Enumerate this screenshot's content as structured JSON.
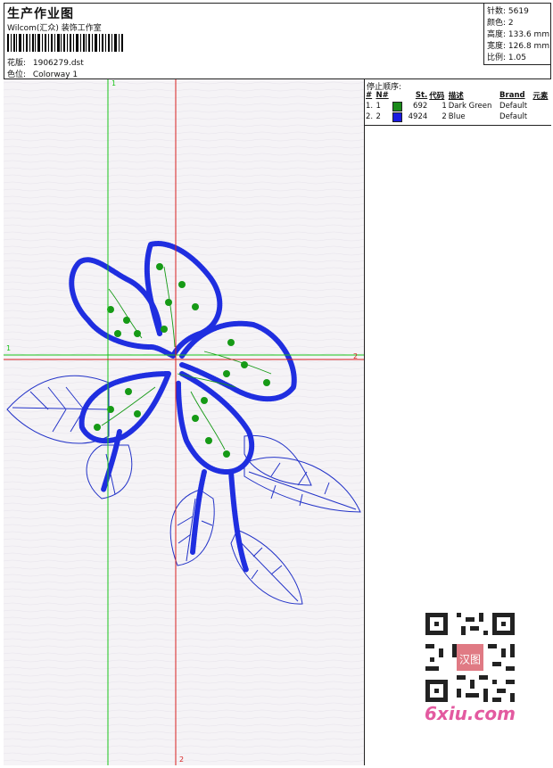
{
  "header": {
    "title": "生产作业图",
    "studio": "Wilcom(汇众) 装饰工作室",
    "file_key": "花版:",
    "file_val": "1906279.dst",
    "color_key": "色位:",
    "color_val": "Colorway 1"
  },
  "stats": [
    {
      "key": "针数:",
      "val": "5619"
    },
    {
      "key": "颜色:",
      "val": "2"
    },
    {
      "key": "高度:",
      "val": "133.6 mm"
    },
    {
      "key": "宽度:",
      "val": "126.8 mm"
    },
    {
      "key": "比例:",
      "val": "1.05"
    }
  ],
  "stop_sequence": {
    "title": "停止顺序:",
    "columns": [
      "#",
      "N#",
      "St.",
      "代码",
      "描述",
      "Brand",
      "元素"
    ],
    "rows": [
      {
        "num": "1.",
        "n": "1",
        "color": "#1a8a1a",
        "st": "692",
        "code": "1",
        "desc": "Dark Green",
        "brand": "Default"
      },
      {
        "num": "2.",
        "n": "2",
        "color": "#1a1ae0",
        "st": "4924",
        "code": "2",
        "desc": "Blue",
        "brand": "Default"
      }
    ]
  },
  "axes": {
    "green_v": "1",
    "green_h": "1",
    "red_h": "2",
    "red_v": "2"
  },
  "colors": {
    "green_axis": "#19c419",
    "red_axis": "#d61f1f",
    "stitch_blue": "#1f2ee0",
    "stitch_green": "#169a16",
    "outline_blue": "#2333c8"
  },
  "watermark": {
    "text": "6xiu.com",
    "seal": "汉图"
  }
}
